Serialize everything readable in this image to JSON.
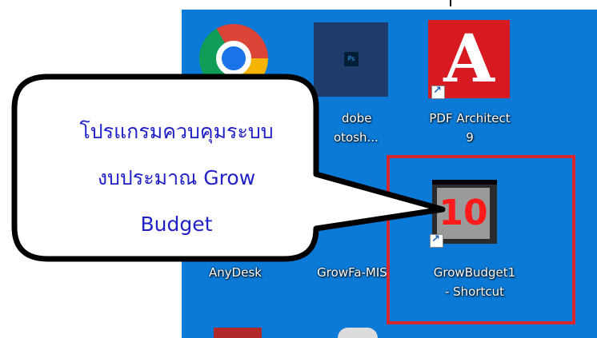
{
  "desktop": {
    "background_color": "#0b79d6",
    "icons": [
      {
        "label": "AnyDesk",
        "icon": "chrome-icon"
      },
      {
        "label": "Adobe Photosh...",
        "label_line1": "dobe",
        "label_line2": "otosh...",
        "icon": "photoshop-icon",
        "badge_text": "Ps"
      },
      {
        "label": "PDF Architect 9",
        "label_line1": "PDF Architect",
        "label_line2": "9",
        "icon": "pdf-architect-icon",
        "glyph": "A"
      },
      {
        "label": "AnyDesk",
        "icon": "anydesk-icon"
      },
      {
        "label": "GrowFa-MIS",
        "icon": "growfa-icon"
      },
      {
        "label": "GrowBudget1 - Shortcut",
        "label_line1": "GrowBudget1",
        "label_line2": "- Shortcut",
        "icon": "growbudget-icon",
        "number": "10"
      }
    ],
    "highlight_color": "#d6262e"
  },
  "callout": {
    "line1": "โปรแกรมควบคุมระบบ",
    "line2": "งบประมาณ Grow",
    "line3": "Budget",
    "text_color": "#2121c8"
  }
}
